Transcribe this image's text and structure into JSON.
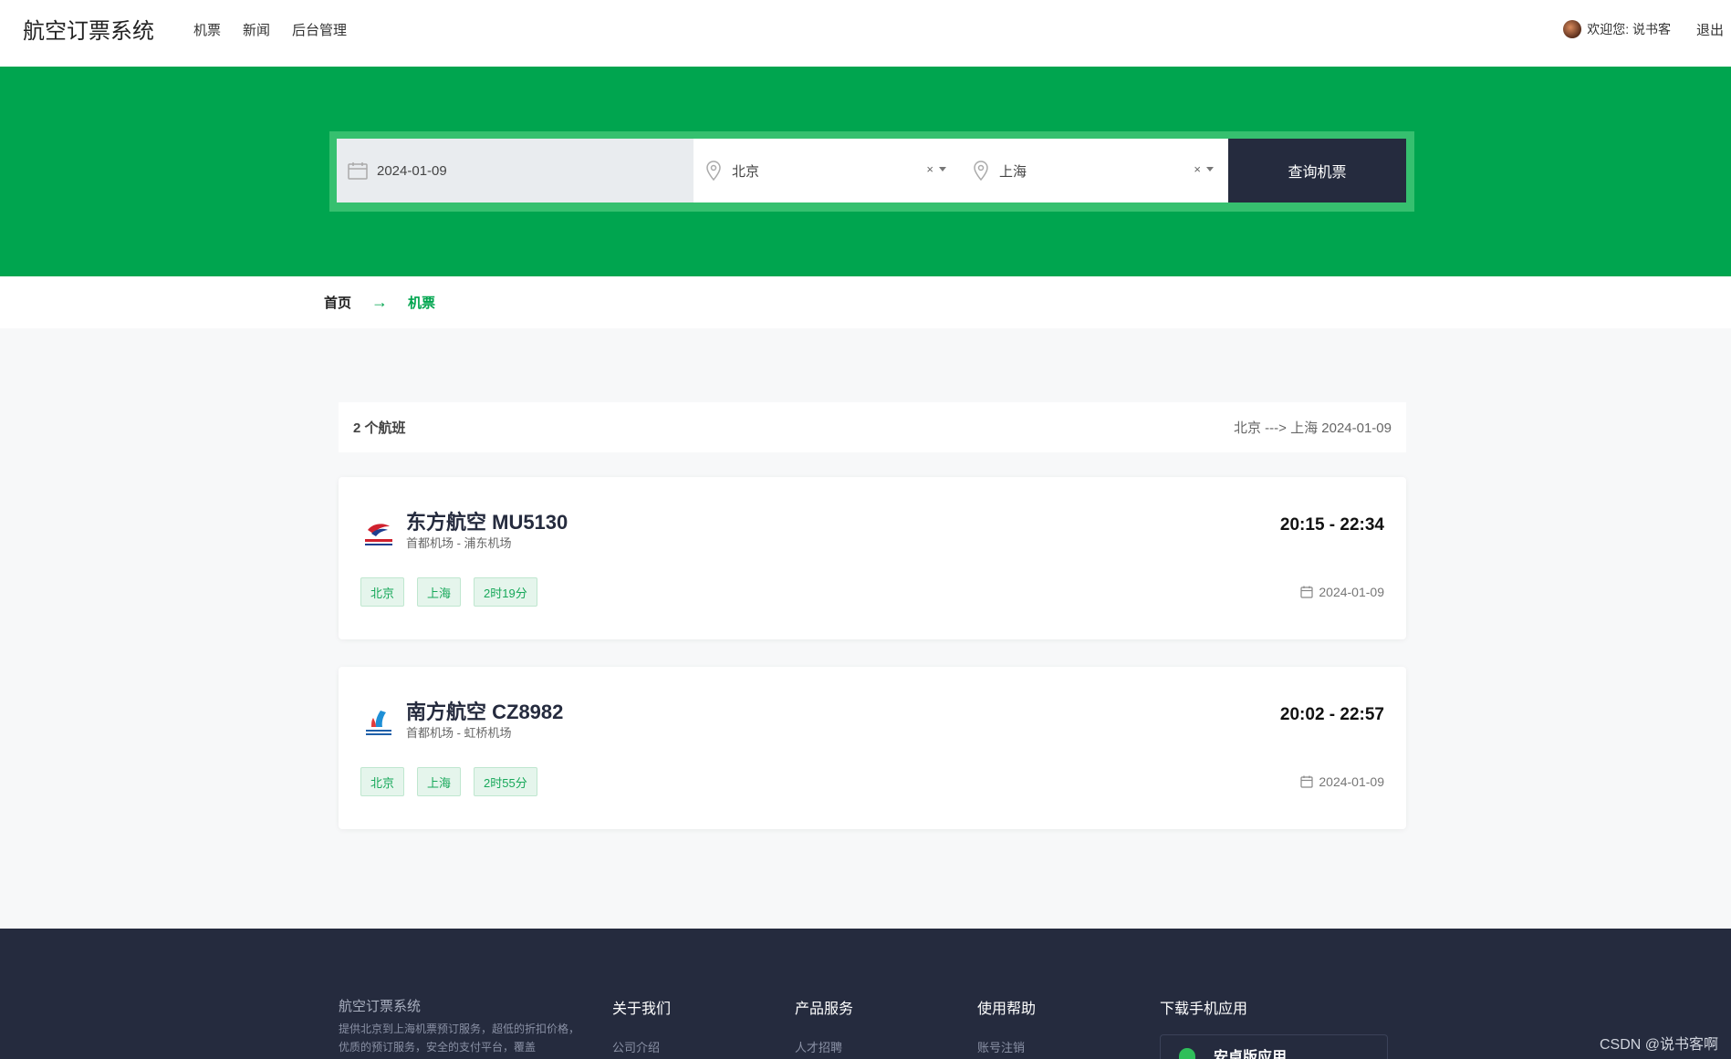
{
  "header": {
    "brand": "航空订票系统",
    "nav": [
      "机票",
      "新闻",
      "后台管理"
    ],
    "welcome": "欢迎您: 说书客",
    "logout": "退出"
  },
  "search": {
    "date": "2024-01-09",
    "from": "北京",
    "to": "上海",
    "clear": "×",
    "button": "查询机票"
  },
  "breadcrumb": {
    "home": "首页",
    "current": "机票"
  },
  "results": {
    "count": "2 个航班",
    "route": "北京 ---> 上海  2024-01-09",
    "flights": [
      {
        "name": "东方航空 MU5130",
        "airports": "首都机场 - 浦东机场",
        "time": "20:15 - 22:34",
        "tags": [
          "北京",
          "上海",
          "2时19分"
        ],
        "date": "2024-01-09"
      },
      {
        "name": "南方航空 CZ8982",
        "airports": "首都机场 - 虹桥机场",
        "time": "20:02 - 22:57",
        "tags": [
          "北京",
          "上海",
          "2时55分"
        ],
        "date": "2024-01-09"
      }
    ]
  },
  "footer": {
    "brand": "航空订票系统",
    "desc": "提供北京到上海机票预订服务，超低的折扣价格，优质的预订服务，安全的支付平台，覆盖",
    "columns": [
      {
        "title": "关于我们",
        "link": "公司介绍"
      },
      {
        "title": "产品服务",
        "link": "人才招聘"
      },
      {
        "title": "使用帮助",
        "link": "账号注销"
      },
      {
        "title": "下载手机应用",
        "link": ""
      }
    ],
    "app": "安卓版应用"
  },
  "watermark": "CSDN @说书客啊",
  "colors": {
    "primary_green": "#00a54f",
    "dark_navy": "#252b3e",
    "tag_green": "#17a85a"
  }
}
